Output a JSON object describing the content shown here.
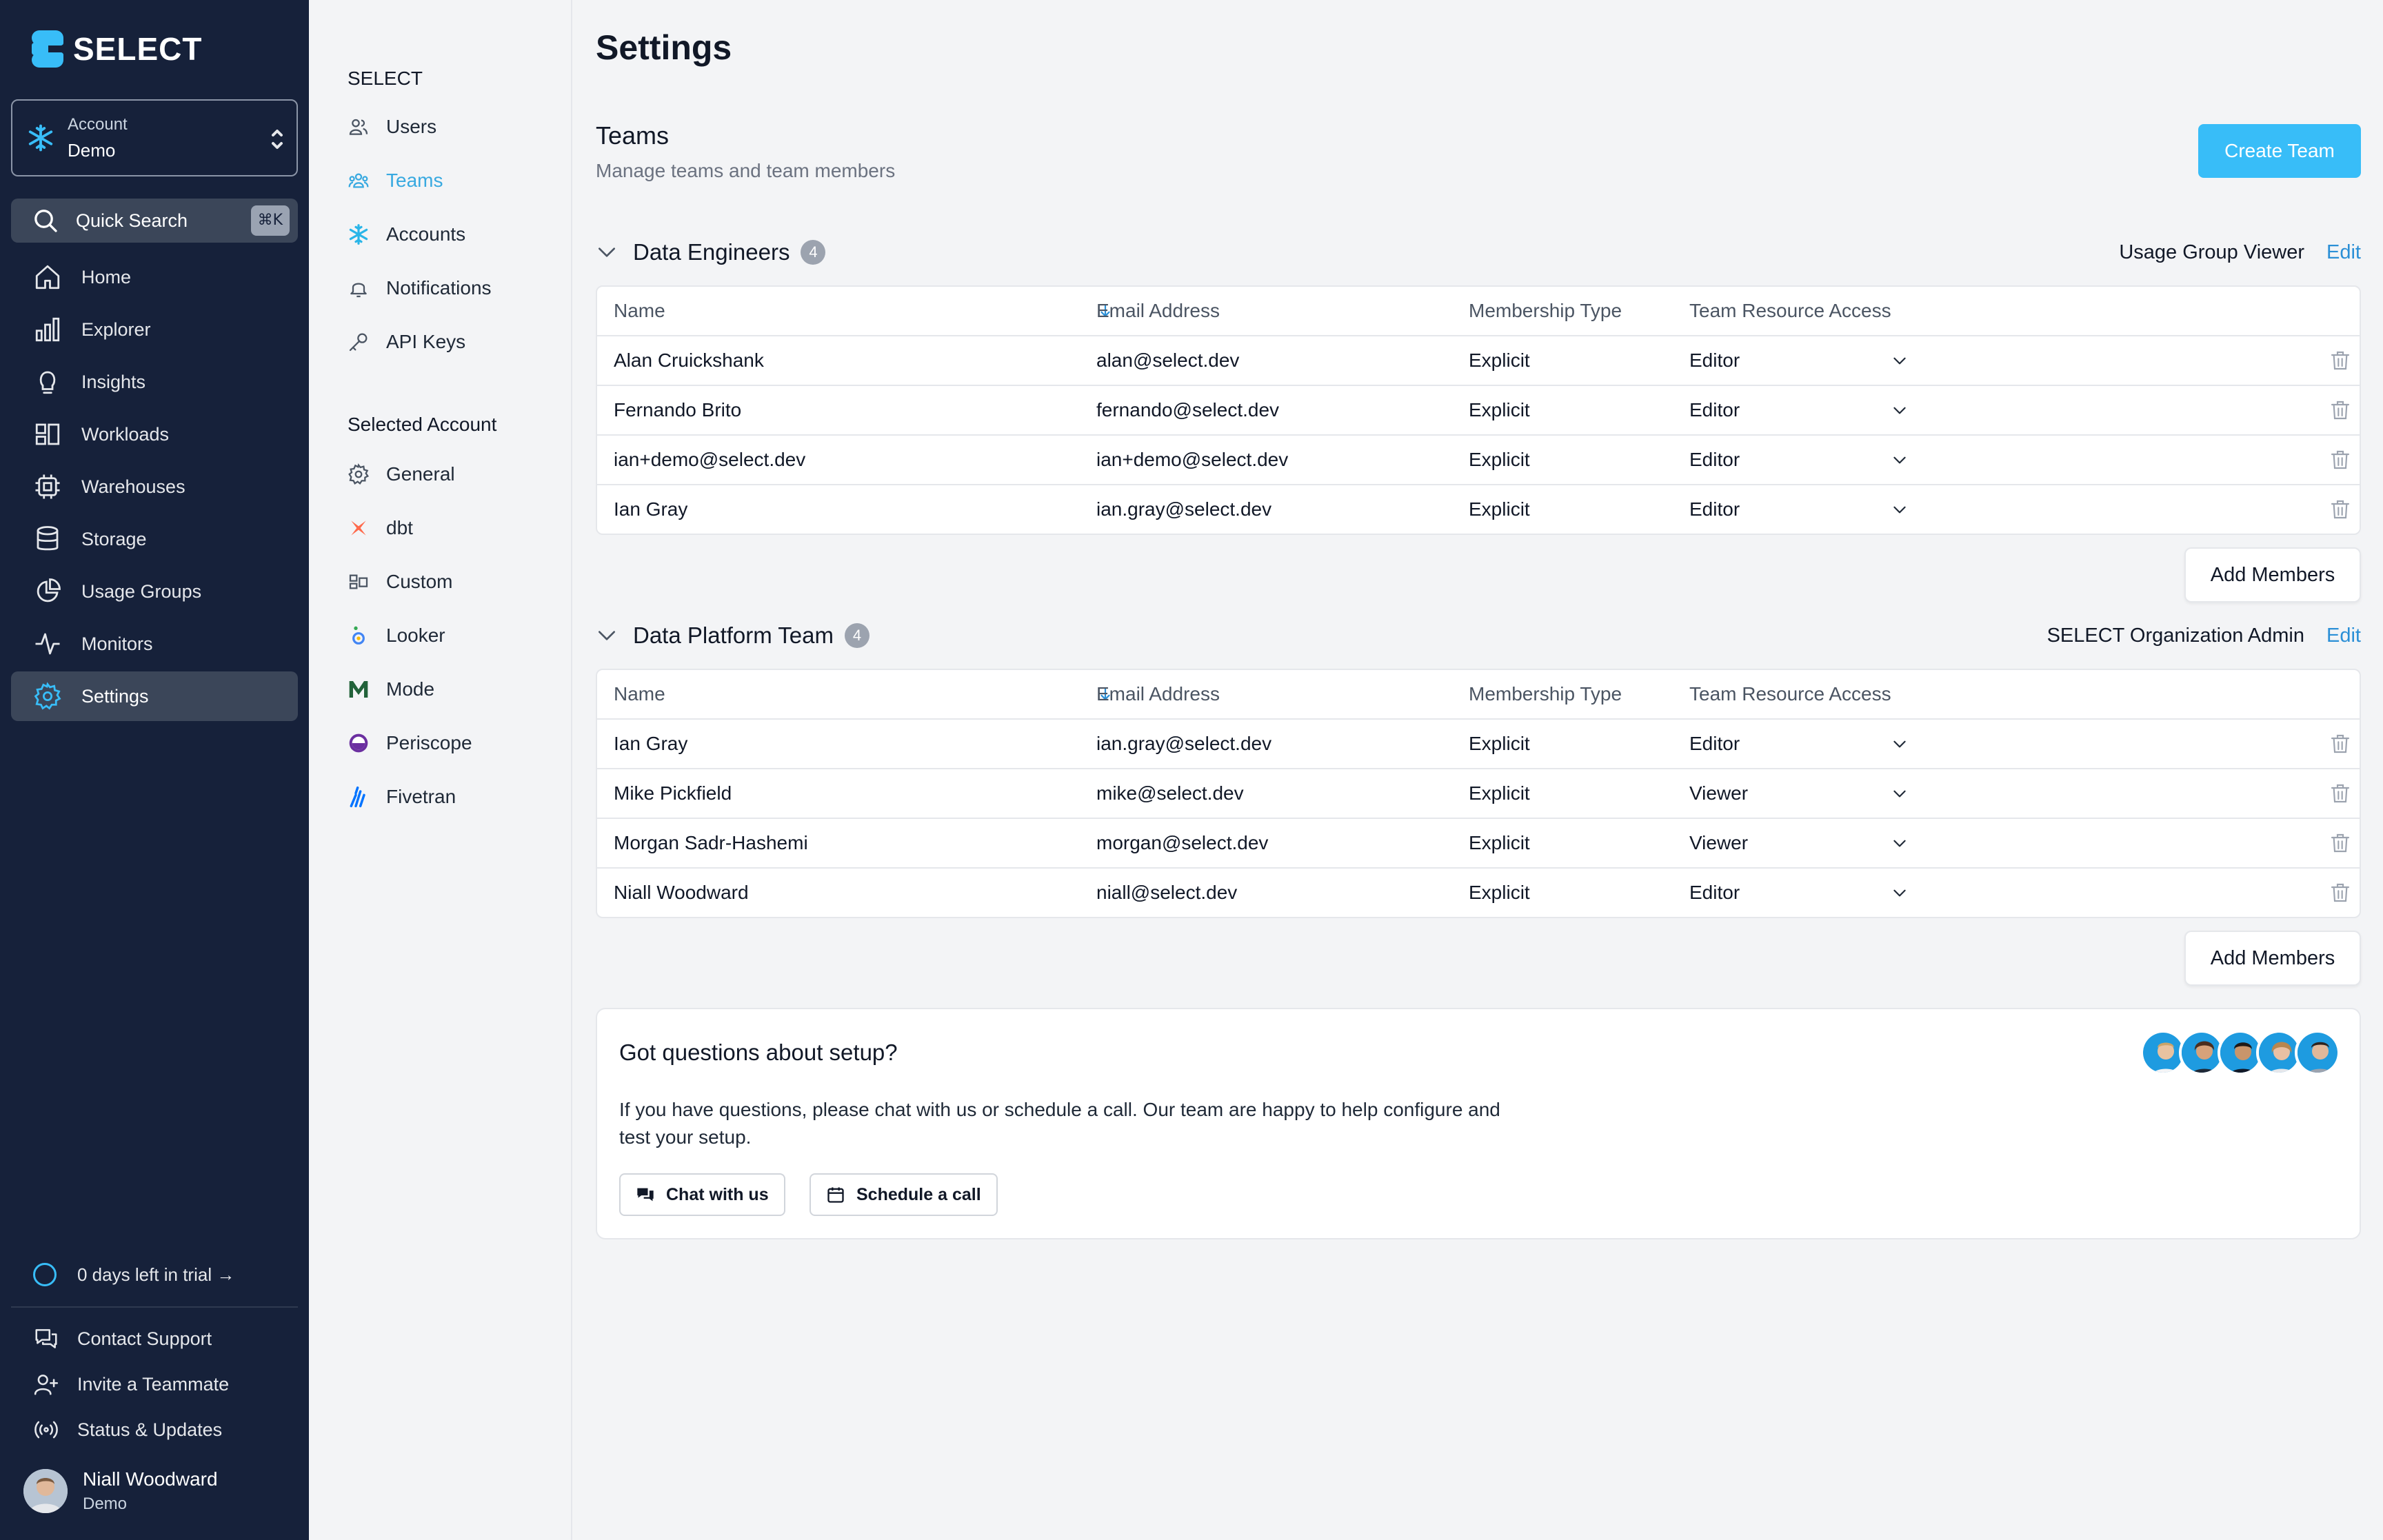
{
  "brand": {
    "name": "SELECT",
    "color": "#38bdf8"
  },
  "account": {
    "label": "Account",
    "value": "Demo"
  },
  "quick_search": {
    "label": "Quick Search",
    "shortcut": "⌘K"
  },
  "nav": [
    {
      "label": "Home",
      "icon": "home-icon"
    },
    {
      "label": "Explorer",
      "icon": "bar-chart-icon"
    },
    {
      "label": "Insights",
      "icon": "lightbulb-icon"
    },
    {
      "label": "Workloads",
      "icon": "workloads-icon"
    },
    {
      "label": "Warehouses",
      "icon": "chip-icon"
    },
    {
      "label": "Storage",
      "icon": "database-icon"
    },
    {
      "label": "Usage Groups",
      "icon": "pie-chart-icon"
    },
    {
      "label": "Monitors",
      "icon": "pulse-icon"
    },
    {
      "label": "Settings",
      "icon": "gear-icon",
      "active": true
    }
  ],
  "trial": {
    "text": "0 days left in trial →"
  },
  "footer": {
    "support": "Contact Support",
    "invite": "Invite a Teammate",
    "status": "Status & Updates"
  },
  "user": {
    "name": "Niall Woodward",
    "org": "Demo"
  },
  "subnav": {
    "section1_title": "SELECT",
    "section1": [
      {
        "label": "Users",
        "icon": "users-icon"
      },
      {
        "label": "Teams",
        "icon": "teams-icon",
        "active": true
      },
      {
        "label": "Accounts",
        "icon": "snowflake-icon"
      },
      {
        "label": "Notifications",
        "icon": "bell-icon"
      },
      {
        "label": "API Keys",
        "icon": "key-icon"
      }
    ],
    "section2_title": "Selected Account",
    "section2": [
      {
        "label": "General",
        "icon": "gear-icon"
      },
      {
        "label": "dbt",
        "icon": "dbt-icon"
      },
      {
        "label": "Custom",
        "icon": "custom-icon"
      },
      {
        "label": "Looker",
        "icon": "looker-icon"
      },
      {
        "label": "Mode",
        "icon": "mode-icon"
      },
      {
        "label": "Periscope",
        "icon": "periscope-icon"
      },
      {
        "label": "Fivetran",
        "icon": "fivetran-icon"
      }
    ]
  },
  "page": {
    "title": "Settings",
    "section_title": "Teams",
    "section_subtitle": "Manage teams and team members",
    "create_button": "Create Team",
    "add_members": "Add Members",
    "edit": "Edit"
  },
  "columns": {
    "name": "Name",
    "email": "Email Address",
    "type": "Membership Type",
    "access": "Team Resource Access"
  },
  "teams": [
    {
      "name": "Data Engineers",
      "count": "4",
      "role": "Usage Group Viewer",
      "members": [
        {
          "name": "Alan Cruickshank",
          "email": "alan@select.dev",
          "type": "Explicit",
          "access": "Editor"
        },
        {
          "name": "Fernando Brito",
          "email": "fernando@select.dev",
          "type": "Explicit",
          "access": "Editor"
        },
        {
          "name": "ian+demo@select.dev",
          "email": "ian+demo@select.dev",
          "type": "Explicit",
          "access": "Editor"
        },
        {
          "name": "Ian Gray",
          "email": "ian.gray@select.dev",
          "type": "Explicit",
          "access": "Editor"
        }
      ]
    },
    {
      "name": "Data Platform Team",
      "count": "4",
      "role": "SELECT Organization Admin",
      "members": [
        {
          "name": "Ian Gray",
          "email": "ian.gray@select.dev",
          "type": "Explicit",
          "access": "Editor"
        },
        {
          "name": "Mike Pickfield",
          "email": "mike@select.dev",
          "type": "Explicit",
          "access": "Viewer"
        },
        {
          "name": "Morgan Sadr-Hashemi",
          "email": "morgan@select.dev",
          "type": "Explicit",
          "access": "Viewer"
        },
        {
          "name": "Niall Woodward",
          "email": "niall@select.dev",
          "type": "Explicit",
          "access": "Editor"
        }
      ]
    }
  ],
  "help": {
    "question": "Got questions about setup?",
    "line1": "If you have questions, please chat with us or schedule a call. Our team are happy to help configure and",
    "line2": "test your setup.",
    "chat_button": "Chat with us",
    "schedule_button": "Schedule a call"
  }
}
